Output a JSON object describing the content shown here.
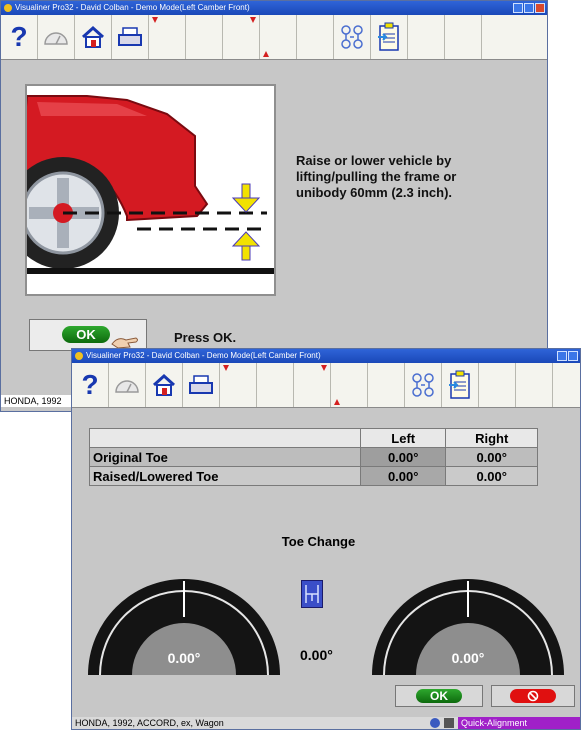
{
  "back_window": {
    "title": "Visualiner Pro32 - David Colban - Demo Mode(Left Camber Front)",
    "toolbar": {
      "help": "?"
    },
    "instruction": "Raise or lower vehicle by lifting/pulling the frame or unibody 60mm (2.3 inch).",
    "ok_label": "OK",
    "press_ok": "Press OK.",
    "status": "HONDA, 1992"
  },
  "front_window": {
    "title": "Visualiner Pro32 - David Colban - Demo Mode(Left Camber Front)",
    "toolbar": {
      "help": "?"
    },
    "table": {
      "headers": [
        "",
        "Left",
        "Right"
      ],
      "rows": [
        {
          "label": "Original Toe",
          "left": "0.00°",
          "right": "0.00°"
        },
        {
          "label": "Raised/Lowered Toe",
          "left": "0.00°",
          "right": "0.00°"
        }
      ]
    },
    "toe_change_title": "Toe Change",
    "left_gauge_value": "0.00°",
    "center_value": "0.00°",
    "right_gauge_value": "0.00°",
    "ok_label": "OK",
    "status": "HONDA, 1992, ACCORD, ex, Wagon",
    "status_right": "Quick-Alignment"
  },
  "icons": [
    "help-icon",
    "gauge-icon",
    "home-icon",
    "printer-icon",
    "vehicle-specs-icon",
    "clipboard-icon",
    "hand-icon",
    "wheel-align-icon",
    "cancel-icon"
  ],
  "colors": {
    "accent_green": "#1a8a1a",
    "cancel_red": "#e01010",
    "toolbar_blue": "#1838b0",
    "arrow_yellow": "#f2e200",
    "car_red": "#d41a22"
  }
}
